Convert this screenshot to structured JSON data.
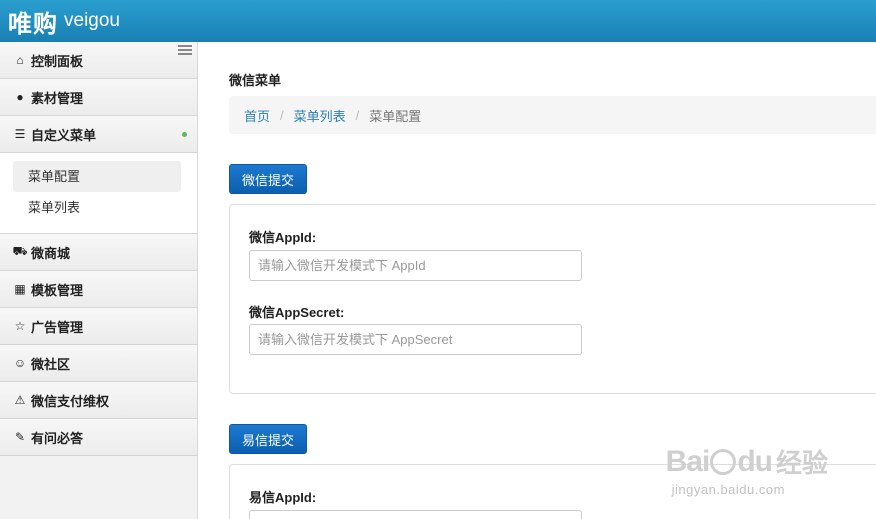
{
  "header": {
    "brand_cn": "唯购",
    "brand_en": "veigou",
    "bg_color": "#1f8bc0"
  },
  "sidebar": {
    "items": [
      {
        "icon": "home-icon",
        "glyph": "⌂",
        "label": "控制面板"
      },
      {
        "icon": "comment-icon",
        "glyph": "●",
        "label": "素材管理"
      },
      {
        "icon": "list-icon",
        "glyph": "☰",
        "label": "自定义菜单"
      },
      {
        "icon": "cart-icon",
        "glyph": "⛟",
        "label": "微商城"
      },
      {
        "icon": "grid-icon",
        "glyph": "▦",
        "label": "模板管理"
      },
      {
        "icon": "star-icon",
        "glyph": "☆",
        "label": "广告管理"
      },
      {
        "icon": "smile-icon",
        "glyph": "☺",
        "label": "微社区"
      },
      {
        "icon": "warning-icon",
        "glyph": "⚠",
        "label": "微信支付维权"
      },
      {
        "icon": "edit-icon",
        "glyph": "✎",
        "label": "有问必答"
      }
    ],
    "submenu": [
      {
        "label": "菜单配置",
        "active": true
      },
      {
        "label": "菜单列表",
        "active": false
      }
    ]
  },
  "main": {
    "title": "微信菜单",
    "breadcrumb": {
      "home": "首页",
      "list": "菜单列表",
      "current": "菜单配置"
    },
    "wechat": {
      "submit_label": "微信提交",
      "appid_label": "微信AppId:",
      "appid_placeholder": "请输入微信开发模式下 AppId",
      "secret_label": "微信AppSecret:",
      "secret_placeholder": "请输入微信开发模式下 AppSecret"
    },
    "yixin": {
      "submit_label": "易信提交",
      "appid_label": "易信AppId:"
    }
  },
  "watermark": {
    "logo": "Bai",
    "logo2": "du",
    "cn": "经验",
    "url": "jingyan.baidu.com"
  },
  "colors": {
    "accent": "#0b5fae",
    "link": "#2a7fb5",
    "active_dot": "#5cb85c"
  }
}
